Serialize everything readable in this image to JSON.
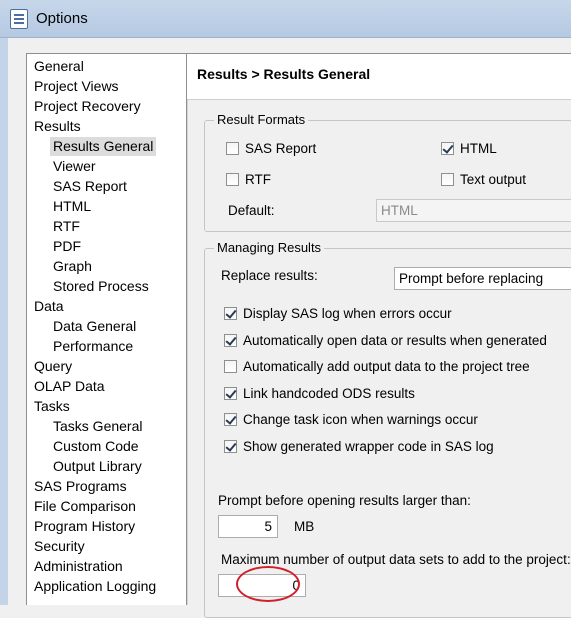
{
  "window": {
    "title": "Options"
  },
  "nav": {
    "items": [
      {
        "label": "General",
        "level": 0
      },
      {
        "label": "Project Views",
        "level": 0
      },
      {
        "label": "Project Recovery",
        "level": 0
      },
      {
        "label": "Results",
        "level": 0
      },
      {
        "label": "Results General",
        "level": 1,
        "selected": true
      },
      {
        "label": "Viewer",
        "level": 1
      },
      {
        "label": "SAS Report",
        "level": 1
      },
      {
        "label": "HTML",
        "level": 1
      },
      {
        "label": "RTF",
        "level": 1
      },
      {
        "label": "PDF",
        "level": 1
      },
      {
        "label": "Graph",
        "level": 1
      },
      {
        "label": "Stored Process",
        "level": 1
      },
      {
        "label": "Data",
        "level": 0
      },
      {
        "label": "Data General",
        "level": 1
      },
      {
        "label": "Performance",
        "level": 1
      },
      {
        "label": "Query",
        "level": 0
      },
      {
        "label": "OLAP Data",
        "level": 0
      },
      {
        "label": "Tasks",
        "level": 0
      },
      {
        "label": "Tasks General",
        "level": 1
      },
      {
        "label": "Custom Code",
        "level": 1
      },
      {
        "label": "Output Library",
        "level": 1
      },
      {
        "label": "SAS Programs",
        "level": 0
      },
      {
        "label": "File Comparison",
        "level": 0
      },
      {
        "label": "Program History",
        "level": 0
      },
      {
        "label": "Security",
        "level": 0
      },
      {
        "label": "Administration",
        "level": 0
      },
      {
        "label": "Application Logging",
        "level": 0
      }
    ]
  },
  "panel": {
    "title": "Results > Results General"
  },
  "result_formats": {
    "group_label": "Result Formats",
    "sas_report": {
      "label": "SAS Report",
      "checked": false
    },
    "html": {
      "label": "HTML",
      "checked": true
    },
    "rtf": {
      "label": "RTF",
      "checked": false
    },
    "text_output": {
      "label": "Text output",
      "checked": false
    },
    "default_label": "Default:",
    "default_value": "HTML"
  },
  "managing_results": {
    "group_label": "Managing Results",
    "replace_label": "Replace results:",
    "replace_value": "Prompt before replacing",
    "options": [
      {
        "label": "Display SAS log when errors occur",
        "checked": true
      },
      {
        "label": "Automatically open data or results when generated",
        "checked": true
      },
      {
        "label": "Automatically add output data to the project tree",
        "checked": false
      },
      {
        "label": "Link handcoded ODS results",
        "checked": true
      },
      {
        "label": "Change task icon when warnings occur",
        "checked": true
      },
      {
        "label": "Show generated wrapper code in SAS log",
        "checked": true
      }
    ],
    "prompt_label": "Prompt before opening results larger than:",
    "prompt_value": "5",
    "prompt_unit": "MB",
    "max_label": "Maximum number of output data sets to add to the project:",
    "max_value": "0"
  },
  "colors": {
    "annotation": "#d0212b",
    "titlebar": "#c7d7ea"
  }
}
